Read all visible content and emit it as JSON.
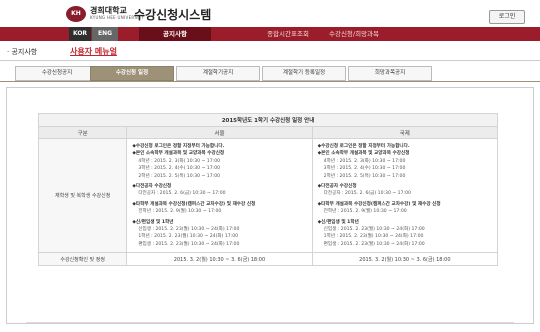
{
  "header": {
    "logo_text": "KH",
    "univ_name": "경희대학교",
    "univ_en": "KYUNG HEE UNIVERSITY",
    "system_name": "수강신청시스템",
    "login_label": "로그인"
  },
  "nav": {
    "lang_kor": "KOR",
    "lang_eng": "ENG",
    "items": [
      "공지사항",
      "종합시간표조회",
      "수강신청/희망과목"
    ]
  },
  "sub": {
    "title": "· 공지사항",
    "manual_link": "사용자 메뉴얼"
  },
  "tabs": [
    "수강신청공지",
    "수강신청 일정",
    "계절학기공지",
    "계절학기 등록일정",
    "희망과목공지"
  ],
  "table": {
    "caption": "2015학년도 1학기 수강신청 일정 안내",
    "col_headers": [
      "구분",
      "서울",
      "국제"
    ],
    "row1_label": "재학생 및 복학생 수강신청",
    "seoul_lines": [
      {
        "t": "◆수강신청 로그인은 정할 지정부터 가능합니다.",
        "k": "b"
      },
      {
        "t": "◆본인 소속학부 개설과목 및 교양과목 수강신청",
        "k": "b"
      },
      {
        "t": "4학년 : 2015. 2. 3(화) 10:30 ~ 17:00",
        "k": "i"
      },
      {
        "t": "3학년 : 2015. 2. 4(수) 10:30 ~ 17:00",
        "k": "i"
      },
      {
        "t": "2학년 : 2015. 2. 5(목) 10:30 ~ 17:00",
        "k": "i"
      },
      {
        "t": "",
        "k": "g"
      },
      {
        "t": "◆다전공자 수강신청",
        "k": "b"
      },
      {
        "t": "다전공자 : 2015. 2. 6(금) 10:30 ~ 17:00",
        "k": "i"
      },
      {
        "t": "",
        "k": "g"
      },
      {
        "t": "◆타학부 개설과목 수강신청(캠퍼스간 교차수강) 및 재수강 신청",
        "k": "b"
      },
      {
        "t": "전학년 : 2015. 2. 9(월) 10:30 ~ 17:00",
        "k": "i"
      },
      {
        "t": "",
        "k": "g"
      },
      {
        "t": "◆신/편입생 및 1학년",
        "k": "b"
      },
      {
        "t": "신입생 : 2015. 2. 23(월) 10:30 ~ 24(화) 17:00",
        "k": "i"
      },
      {
        "t": "1학년 : 2015. 2. 23(월) 10:30 ~ 24(화) 17:00",
        "k": "i"
      },
      {
        "t": "편입생 : 2015. 2. 23(월) 10:30 ~ 24(화) 17:00",
        "k": "i"
      }
    ],
    "global_lines": [
      {
        "t": "◆수강신청 로그인은 정할 지정부터 가능합니다.",
        "k": "b"
      },
      {
        "t": "◆본인 소속학부 개설과목 및 교양과목 수강신청",
        "k": "b"
      },
      {
        "t": "4학년 : 2015. 2. 3(화) 10:30 ~ 17:00",
        "k": "i"
      },
      {
        "t": "3학년 : 2015. 2. 4(수) 10:30 ~ 17:00",
        "k": "i"
      },
      {
        "t": "2학년 : 2015. 2. 5(목) 10:30 ~ 17:00",
        "k": "i"
      },
      {
        "t": "",
        "k": "g"
      },
      {
        "t": "◆다전공자 수강신청",
        "k": "b"
      },
      {
        "t": "다전공자 : 2015. 2. 6(금) 10:30 ~ 17:00",
        "k": "i"
      },
      {
        "t": "",
        "k": "g"
      },
      {
        "t": "◆타학부 개설과목 수강신청(캠퍼스간 교차수강) 및 재수강 신청",
        "k": "b"
      },
      {
        "t": "전학년 : 2015. 2. 9(월) 10:30 ~ 17:00",
        "k": "i"
      },
      {
        "t": "",
        "k": "g"
      },
      {
        "t": "◆신/편입생 및 1학년",
        "k": "b"
      },
      {
        "t": "신입생 : 2015. 2. 23(월) 10:30 ~ 24(화) 17:00",
        "k": "i"
      },
      {
        "t": "1학년 : 2015. 2. 23(월) 10:30 ~ 24(화) 17:00",
        "k": "i"
      },
      {
        "t": "편입생 : 2015. 2. 23(월) 10:30 ~ 24(화) 17:00",
        "k": "i"
      }
    ],
    "row2_label": "수강신청확인 및 정정",
    "row2_seoul": "2015. 3. 2(월) 10:30 ~ 3. 6(금) 18:00",
    "row2_global": "2015. 3. 2(월) 10:30 ~ 3. 6(금) 18:00"
  },
  "colors": {
    "brand": "#9b1c2a",
    "tab_active": "#9d9277",
    "link": "#c0262d"
  }
}
